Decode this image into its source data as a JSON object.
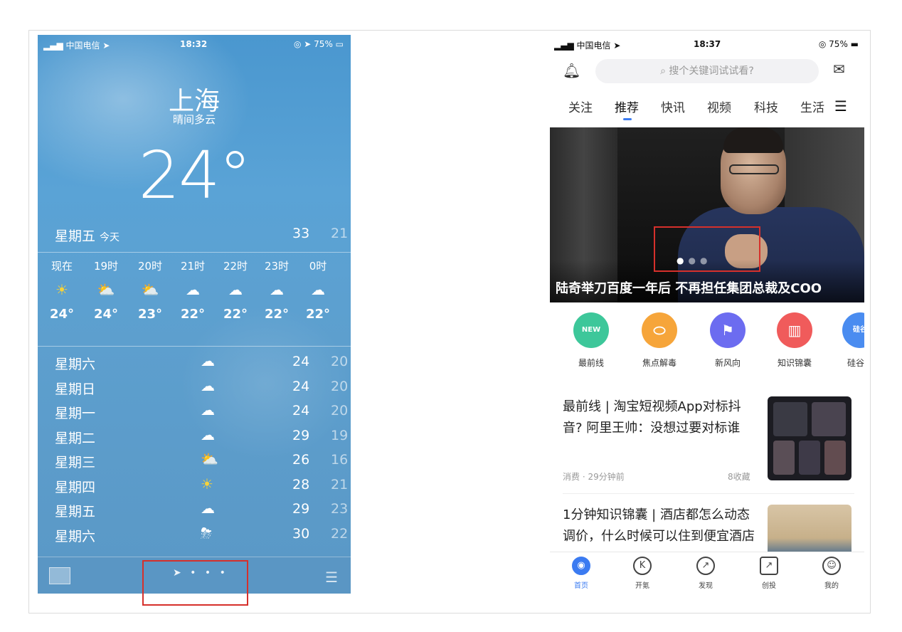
{
  "weather": {
    "status": {
      "carrier": "▂▄▆ 中国电信 ➤",
      "time": "18:32",
      "right": "◎ ➤ 75% ▭"
    },
    "city": "上海",
    "condition": "晴间多云",
    "temperature": "24°",
    "today": {
      "day": "星期五",
      "tag": "今天",
      "high": "33",
      "low": "21"
    },
    "hourly": [
      {
        "label": "现在",
        "icon": "sun-icon",
        "glyph": "☀",
        "temp": "24°"
      },
      {
        "label": "19时",
        "icon": "partly-cloudy-icon",
        "glyph": "⛅",
        "temp": "24°"
      },
      {
        "label": "20时",
        "icon": "partly-cloudy-icon",
        "glyph": "⛅",
        "temp": "23°"
      },
      {
        "label": "21时",
        "icon": "cloud-icon",
        "glyph": "☁",
        "temp": "22°"
      },
      {
        "label": "22时",
        "icon": "cloud-icon",
        "glyph": "☁",
        "temp": "22°"
      },
      {
        "label": "23时",
        "icon": "cloud-icon",
        "glyph": "☁",
        "temp": "22°"
      },
      {
        "label": "0时",
        "icon": "cloud-icon",
        "glyph": "☁",
        "temp": "22°"
      }
    ],
    "daily": [
      {
        "day": "星期六",
        "icon": "rain-cloud-icon",
        "glyph": "☁",
        "high": "24",
        "low": "20"
      },
      {
        "day": "星期日",
        "icon": "rain-cloud-icon",
        "glyph": "☁",
        "high": "24",
        "low": "20"
      },
      {
        "day": "星期一",
        "icon": "cloud-icon",
        "glyph": "☁",
        "high": "24",
        "low": "20"
      },
      {
        "day": "星期二",
        "icon": "rain-cloud-icon",
        "glyph": "☁",
        "high": "29",
        "low": "19"
      },
      {
        "day": "星期三",
        "icon": "partly-sunny-icon",
        "glyph": "⛅",
        "high": "26",
        "low": "16"
      },
      {
        "day": "星期四",
        "icon": "sun-icon",
        "glyph": "☀",
        "high": "28",
        "low": "21"
      },
      {
        "day": "星期五",
        "icon": "cloud-icon",
        "glyph": "☁",
        "high": "29",
        "low": "23"
      },
      {
        "day": "星期六",
        "icon": "thunder-cloud-icon",
        "glyph": "⛈",
        "high": "30",
        "low": "22"
      }
    ],
    "bottom": {
      "dots": "➤ • • •",
      "list_glyph": "☰"
    }
  },
  "news": {
    "status": {
      "carrier": "▂▄▆ 中国电信 ➤",
      "time": "18:37",
      "right": "◎ 75% ▬"
    },
    "search_placeholder": "⌕ 搜个关键词试试看?",
    "tabs": [
      "关注",
      "推荐",
      "快讯",
      "视频",
      "科技",
      "生活"
    ],
    "active_tab": "推荐",
    "banner_caption": "陆奇举刀百度一年后 不再担任集团总裁及COO",
    "shortcuts": [
      {
        "label": "最前线",
        "icon": "new-badge-icon",
        "glyph": "NEW",
        "color": "#3dc79a"
      },
      {
        "label": "焦点解毒",
        "icon": "pill-icon",
        "glyph": "⬭",
        "color": "#f6a53a"
      },
      {
        "label": "新风向",
        "icon": "flag-icon",
        "glyph": "⚑",
        "color": "#6c6cf0"
      },
      {
        "label": "知识锦囊",
        "icon": "book-icon",
        "glyph": "▥",
        "color": "#f05b5b"
      },
      {
        "label": "硅谷工",
        "icon": "silicon-valley-icon",
        "glyph": "硅谷",
        "color": "#4a8cf0"
      }
    ],
    "articles": [
      {
        "title": "最前线 | 淘宝短视频App对标抖音? 阿里王帅：没想过要对标谁",
        "meta": "消费 · 29分钟前",
        "count": "8收藏"
      },
      {
        "title": "1分钟知识锦囊 | 酒店都怎么动态调价，什么时候可以住到便宜酒店",
        "meta": "",
        "count": ""
      }
    ],
    "tabbar": [
      {
        "label": "首页",
        "icon": "home-icon",
        "glyph": "◉"
      },
      {
        "label": "开氪",
        "icon": "kr-icon",
        "glyph": "K"
      },
      {
        "label": "发现",
        "icon": "compass-icon",
        "glyph": "↗"
      },
      {
        "label": "创投",
        "icon": "chart-icon",
        "glyph": "↗"
      },
      {
        "label": "我的",
        "icon": "user-icon",
        "glyph": "☺"
      }
    ]
  }
}
